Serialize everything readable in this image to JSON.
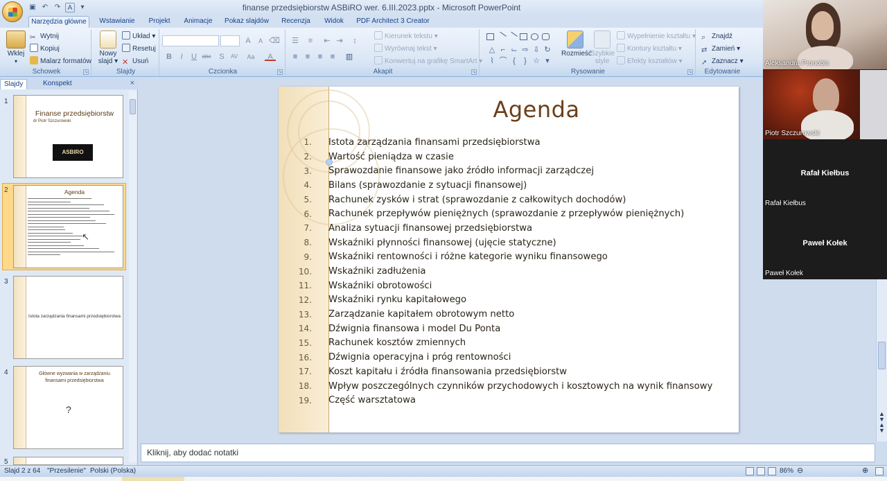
{
  "window": {
    "title": "finanse przedsiębiorstw ASBiRO wer. 6.III.2023.pptx - Microsoft PowerPoint"
  },
  "ribbon": {
    "tabs": [
      {
        "label": "Narzędzia główne"
      },
      {
        "label": "Wstawianie"
      },
      {
        "label": "Projekt"
      },
      {
        "label": "Animacje"
      },
      {
        "label": "Pokaz slajdów"
      },
      {
        "label": "Recenzja"
      },
      {
        "label": "Widok"
      },
      {
        "label": "PDF Architect 3 Creator"
      }
    ],
    "clipboard": {
      "label": "Schowek",
      "paste": "Wklej",
      "cut": "Wytnij",
      "copy": "Kopiuj",
      "painter": "Malarz formatów"
    },
    "slides": {
      "label": "Slajdy",
      "new_slide": "Nowy slajd",
      "layout": "Układ",
      "reset": "Resetuj",
      "delete": "Usuń"
    },
    "font": {
      "label": "Czcionka",
      "bold": "B",
      "italic": "I",
      "underline": "U",
      "strike": "abc",
      "shadow": "S",
      "spacing": "AV",
      "case": "Aa",
      "color": "A",
      "grow": "A",
      "shrink": "A"
    },
    "paragraph": {
      "label": "Akapit",
      "text_direction": "Kierunek tekstu",
      "align_text": "Wyrównaj tekst",
      "smartart": "Konwertuj na grafikę SmartArt"
    },
    "drawing": {
      "label": "Rysowanie",
      "arrange": "Rozmieść",
      "quick_styles": "Szybkie style",
      "fill": "Wypełnienie kształtu",
      "outline": "Kontury kształtu",
      "effects": "Efekty kształtów"
    },
    "editing": {
      "label": "Edytowanie",
      "find": "Znajdź",
      "replace": "Zamień",
      "select": "Zaznacz"
    }
  },
  "left_pane": {
    "tabs": [
      {
        "label": "Slajdy"
      },
      {
        "label": "Konspekt"
      }
    ],
    "close": "×",
    "thumbnails": [
      {
        "num": "1",
        "title": "Finanse przedsiębiorstw",
        "subtitle": "dr Piotr Szczurowski",
        "logo": "ASBIRO"
      },
      {
        "num": "2",
        "title": "Agenda"
      },
      {
        "num": "3",
        "title": "Istota zarządzania finansami przedsiębiorstwa"
      },
      {
        "num": "4",
        "title": "Główne wyzwania w zarządzaniu finansami przedsiębiorstwa",
        "mark": "?"
      },
      {
        "num": "5"
      }
    ]
  },
  "slide": {
    "title": "Agenda",
    "items": [
      {
        "num": "1.",
        "text": "Istota zarządzania finansami przedsiębiorstwa"
      },
      {
        "num": "2.",
        "text": "Wartość pieniądza w czasie"
      },
      {
        "num": "3.",
        "text": "Sprawozdanie finansowe jako źródło informacji zarządczej"
      },
      {
        "num": "4.",
        "text": "Bilans (sprawozdanie z sytuacji finansowej)"
      },
      {
        "num": "5.",
        "text": "Rachunek zysków i strat (sprawozdanie z całkowitych dochodów)"
      },
      {
        "num": "6.",
        "text": "Rachunek przepływów pieniężnych (sprawozdanie z przepływów pieniężnych)"
      },
      {
        "num": "7.",
        "text": "Analiza sytuacji finansowej przedsiębiorstwa"
      },
      {
        "num": "8.",
        "text": "Wskaźniki płynności finansowej (ujęcie statyczne)"
      },
      {
        "num": "9.",
        "text": "Wskaźniki rentowności i różne kategorie wyniku finansowego"
      },
      {
        "num": "10.",
        "text": "Wskaźniki zadłużenia"
      },
      {
        "num": "11.",
        "text": "Wskaźniki obrotowości"
      },
      {
        "num": "12.",
        "text": "Wskaźniki rynku kapitałowego"
      },
      {
        "num": "13.",
        "text": "Zarządzanie kapitałem obrotowym netto"
      },
      {
        "num": "14.",
        "text": "Dźwignia finansowa i model Du Ponta"
      },
      {
        "num": "15.",
        "text": "Rachunek kosztów zmiennych"
      },
      {
        "num": "16.",
        "text": "Dźwignia operacyjna i próg rentowności"
      },
      {
        "num": "17.",
        "text": "Koszt kapitału i źródła finansowania przedsiębiorstw"
      },
      {
        "num": "18.",
        "text": "Wpływ poszczególnych czynników przychodowych i kosztowych na wynik finansowy"
      },
      {
        "num": "19.",
        "text": "Część warsztatowa"
      }
    ]
  },
  "notes": {
    "placeholder": "Kliknij, aby dodać notatki"
  },
  "status": {
    "slide": "Slajd 2 z 64",
    "theme": "\"Przesilenie\"",
    "language": "Polski (Polska)",
    "zoom": "86%"
  },
  "video": {
    "participants": [
      {
        "name": "Aleksandra Pronobis"
      },
      {
        "name": "Piotr Szczurowski"
      },
      {
        "name": "Rafał Kiełbus",
        "label": "Rafał Kiełbus"
      },
      {
        "name": "Paweł Kołek",
        "label": "Paweł Kołek"
      }
    ]
  }
}
